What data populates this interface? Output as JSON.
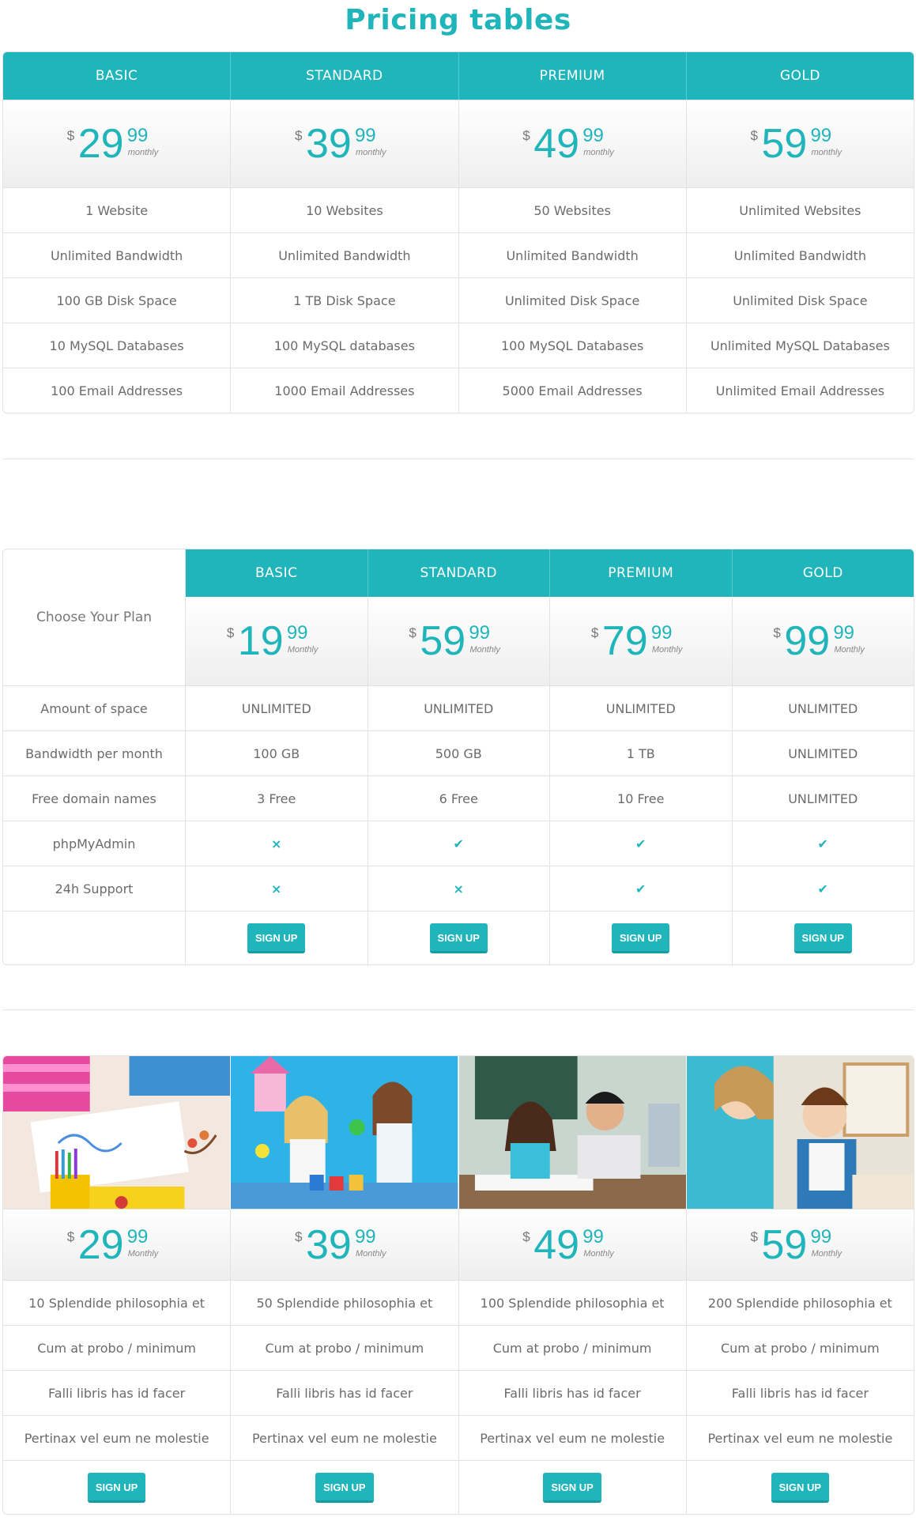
{
  "title": "Pricing tables",
  "table1": {
    "plans": [
      {
        "name": "BASIC",
        "currency": "$",
        "amount": "29",
        "cents": "99",
        "period": "monthly"
      },
      {
        "name": "STANDARD",
        "currency": "$",
        "amount": "39",
        "cents": "99",
        "period": "monthly"
      },
      {
        "name": "PREMIUM",
        "currency": "$",
        "amount": "49",
        "cents": "99",
        "period": "monthly"
      },
      {
        "name": "GOLD",
        "currency": "$",
        "amount": "59",
        "cents": "99",
        "period": "monthly"
      }
    ],
    "features": [
      [
        "1 Website",
        "10 Websites",
        "50 Websites",
        "Unlimited Websites"
      ],
      [
        "Unlimited Bandwidth",
        "Unlimited Bandwidth",
        "Unlimited Bandwidth",
        "Unlimited Bandwidth"
      ],
      [
        "100 GB Disk Space",
        "1 TB Disk Space",
        "Unlimited Disk Space",
        "Unlimited Disk Space"
      ],
      [
        "10 MySQL Databases",
        "100 MySQL databases",
        "100 MySQL Databases",
        "Unlimited MySQL Databases"
      ],
      [
        "100 Email Addresses",
        "1000 Email Addresses",
        "5000 Email Addresses",
        "Unlimited Email Addresses"
      ]
    ]
  },
  "table2": {
    "corner_label": "Choose Your Plan",
    "plans": [
      {
        "name": "BASIC",
        "currency": "$",
        "amount": "19",
        "cents": "99",
        "period": "Monthly"
      },
      {
        "name": "STANDARD",
        "currency": "$",
        "amount": "59",
        "cents": "99",
        "period": "Monthly"
      },
      {
        "name": "PREMIUM",
        "currency": "$",
        "amount": "79",
        "cents": "99",
        "period": "Monthly"
      },
      {
        "name": "GOLD",
        "currency": "$",
        "amount": "99",
        "cents": "99",
        "period": "Monthly"
      }
    ],
    "rows": [
      {
        "label": "Amount of space",
        "values": [
          "UNLIMITED",
          "UNLIMITED",
          "UNLIMITED",
          "UNLIMITED"
        ]
      },
      {
        "label": "Bandwidth per month",
        "values": [
          "100 GB",
          "500 GB",
          "1 TB",
          "UNLIMITED"
        ]
      },
      {
        "label": "Free domain names",
        "values": [
          "3 Free",
          "6 Free",
          "10 Free",
          "UNLIMITED"
        ]
      },
      {
        "label": "phpMyAdmin",
        "values": [
          "cross-icon",
          "check-icon",
          "check-icon",
          "check-icon"
        ]
      },
      {
        "label": "24h Support",
        "values": [
          "cross-icon",
          "cross-icon",
          "check-icon",
          "check-icon"
        ]
      }
    ],
    "signup_label": "SIGN UP"
  },
  "table3": {
    "photos": [
      "child-drawing-photo",
      "children-painting-photo",
      "teacher-student-photo",
      "teacher-boy-photo"
    ],
    "plans": [
      {
        "currency": "$",
        "amount": "29",
        "cents": "99",
        "period": "Monthly"
      },
      {
        "currency": "$",
        "amount": "39",
        "cents": "99",
        "period": "Monthly"
      },
      {
        "currency": "$",
        "amount": "49",
        "cents": "99",
        "period": "Monthly"
      },
      {
        "currency": "$",
        "amount": "59",
        "cents": "99",
        "period": "Monthly"
      }
    ],
    "features": [
      [
        "10 Splendide philosophia et",
        "50 Splendide philosophia et",
        "100 Splendide philosophia et",
        "200 Splendide philosophia et"
      ],
      [
        "Cum at probo / minimum",
        "Cum at probo / minimum",
        "Cum at probo / minimum",
        "Cum at probo / minimum"
      ],
      [
        "Falli libris has id facer",
        "Falli libris has id facer",
        "Falli libris has id facer",
        "Falli libris has id facer"
      ],
      [
        "Pertinax vel eum ne molestie",
        "Pertinax vel eum ne molestie",
        "Pertinax vel eum ne molestie",
        "Pertinax vel eum ne molestie"
      ]
    ],
    "signup_label": "SIGN UP"
  },
  "colors": {
    "accent": "#1fb5bb",
    "border": "#e2e2e2",
    "text": "#6b6b6b"
  }
}
